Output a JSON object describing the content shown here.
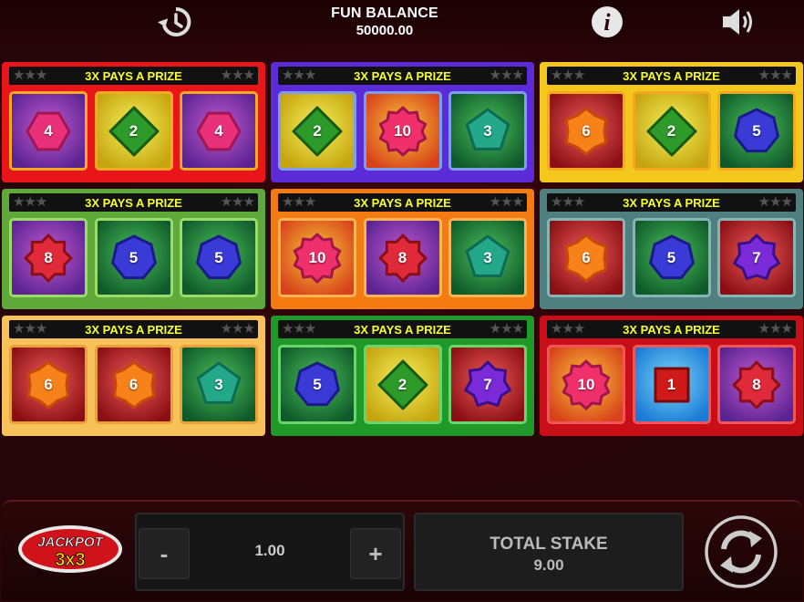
{
  "header": {
    "balance_label": "FUN BALANCE",
    "balance_value": "50000.00",
    "history_icon": "history-icon",
    "info_icon": "info-icon",
    "sound_icon": "speaker-icon"
  },
  "cards": [
    {
      "prize_text": "3X PAYS A PRIZE",
      "theme": "red",
      "cells": [
        {
          "shape": "hexagon",
          "value": "4",
          "bg": "purple"
        },
        {
          "shape": "diamond",
          "value": "2",
          "bg": "yellow"
        },
        {
          "shape": "hexagon",
          "value": "4",
          "bg": "purple"
        }
      ]
    },
    {
      "prize_text": "3X PAYS A PRIZE",
      "theme": "purple",
      "cells": [
        {
          "shape": "diamond",
          "value": "2",
          "bg": "yellow"
        },
        {
          "shape": "burst",
          "value": "10",
          "bg": "orange"
        },
        {
          "shape": "pentagon",
          "value": "3",
          "bg": "green"
        }
      ]
    },
    {
      "prize_text": "3X PAYS A PRIZE",
      "theme": "yellow",
      "cells": [
        {
          "shape": "octagon",
          "value": "6",
          "bg": "red"
        },
        {
          "shape": "diamond",
          "value": "2",
          "bg": "yellow"
        },
        {
          "shape": "heptagon",
          "value": "5",
          "bg": "green"
        }
      ]
    },
    {
      "prize_text": "3X PAYS A PRIZE",
      "theme": "green",
      "cells": [
        {
          "shape": "star8",
          "value": "8",
          "bg": "purple"
        },
        {
          "shape": "heptagon",
          "value": "5",
          "bg": "green"
        },
        {
          "shape": "heptagon",
          "value": "5",
          "bg": "green"
        }
      ]
    },
    {
      "prize_text": "3X PAYS A PRIZE",
      "theme": "orange",
      "cells": [
        {
          "shape": "burst",
          "value": "10",
          "bg": "orange"
        },
        {
          "shape": "star8",
          "value": "8",
          "bg": "purple"
        },
        {
          "shape": "pentagon",
          "value": "3",
          "bg": "green"
        }
      ]
    },
    {
      "prize_text": "3X PAYS A PRIZE",
      "theme": "teal",
      "cells": [
        {
          "shape": "octagon",
          "value": "6",
          "bg": "red"
        },
        {
          "shape": "heptagon",
          "value": "5",
          "bg": "green"
        },
        {
          "shape": "star7",
          "value": "7",
          "bg": "red"
        }
      ]
    },
    {
      "prize_text": "3X PAYS A PRIZE",
      "theme": "peach",
      "cells": [
        {
          "shape": "octagon",
          "value": "6",
          "bg": "red"
        },
        {
          "shape": "octagon",
          "value": "6",
          "bg": "red"
        },
        {
          "shape": "pentagon",
          "value": "3",
          "bg": "green"
        }
      ]
    },
    {
      "prize_text": "3X PAYS A PRIZE",
      "theme": "darkgreen",
      "cells": [
        {
          "shape": "heptagon",
          "value": "5",
          "bg": "green"
        },
        {
          "shape": "diamond",
          "value": "2",
          "bg": "yellow"
        },
        {
          "shape": "star7",
          "value": "7",
          "bg": "red"
        }
      ]
    },
    {
      "prize_text": "3X PAYS A PRIZE",
      "theme": "crimson",
      "cells": [
        {
          "shape": "burst",
          "value": "10",
          "bg": "orange"
        },
        {
          "shape": "square",
          "value": "1",
          "bg": "blue"
        },
        {
          "shape": "star8",
          "value": "8",
          "bg": "purple"
        }
      ]
    }
  ],
  "controls": {
    "logo_text_top": "JACKPOT",
    "logo_text_bottom": "3x3",
    "minus_label": "-",
    "plus_label": "+",
    "stake_value": "1.00",
    "total_stake_label": "TOTAL STAKE",
    "total_stake_value": "9.00",
    "play_icon": "refresh-icon"
  },
  "colors": {
    "prize_text": "#f6ff2a",
    "background": "#2a0407"
  }
}
